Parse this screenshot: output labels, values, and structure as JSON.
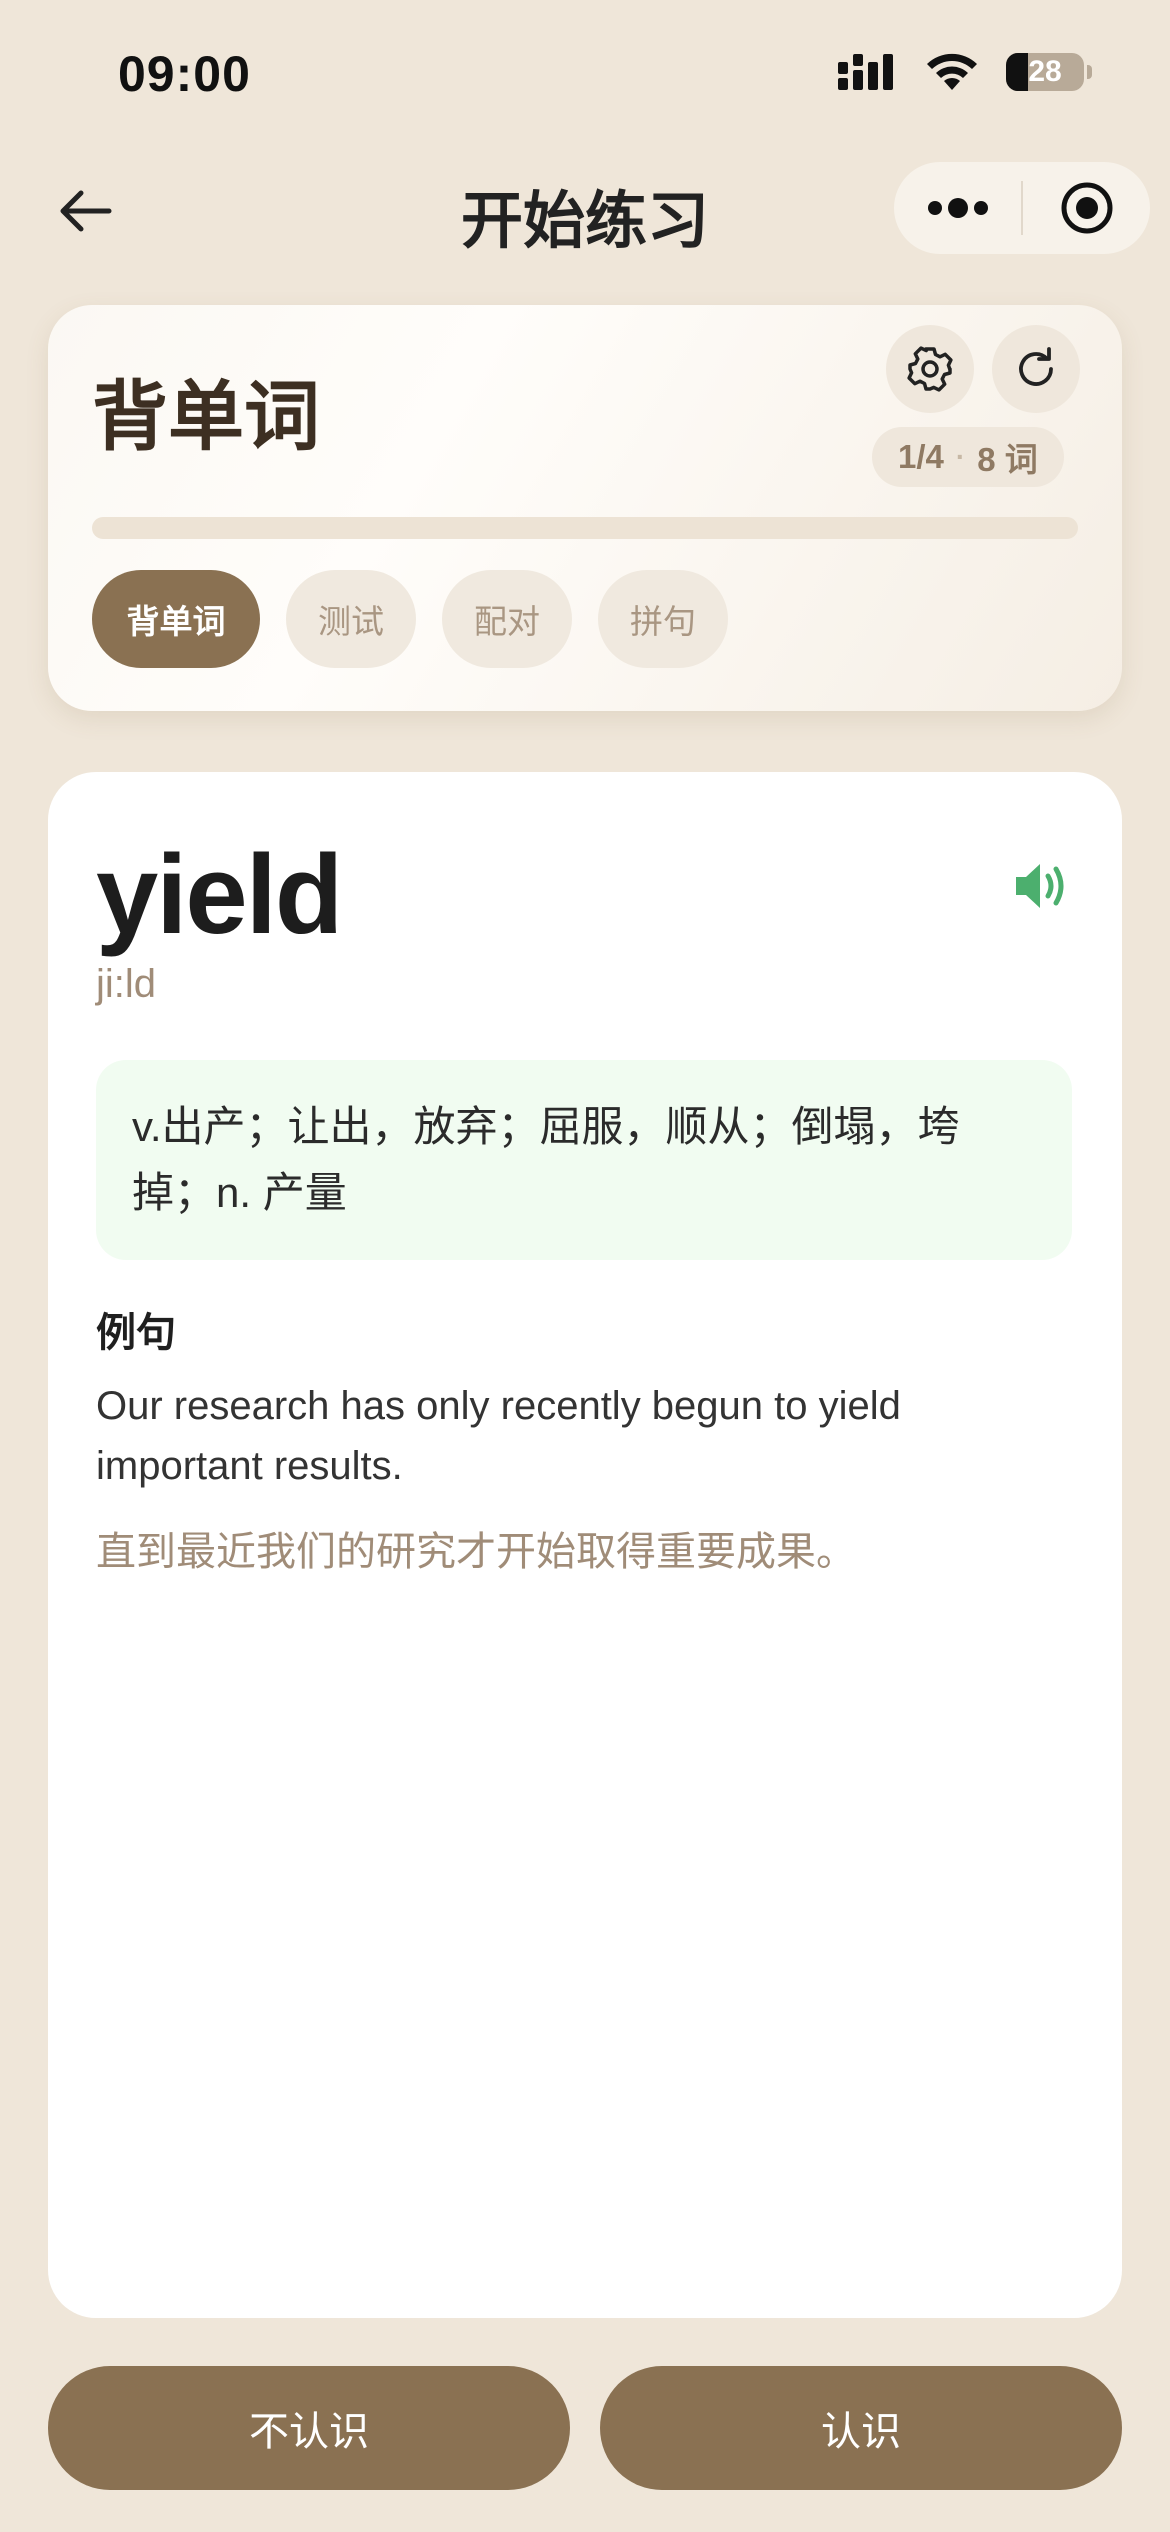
{
  "status_bar": {
    "time": "09:00",
    "battery": "28",
    "battery_level": 0.28
  },
  "nav": {
    "title": "开始练习",
    "back_icon": "arrow-left-icon",
    "menu_icon": "more-dots-icon",
    "target_icon": "record-circle-icon"
  },
  "header": {
    "mode_title": "背单词",
    "progress": {
      "position": "1/4",
      "separator": "·",
      "count": "8 词",
      "fraction": 0
    },
    "tabs": [
      {
        "label": "背单词",
        "active": true
      },
      {
        "label": "测试",
        "active": false
      },
      {
        "label": "配对",
        "active": false
      },
      {
        "label": "拼句",
        "active": false
      }
    ]
  },
  "card": {
    "word": "yield",
    "phonetic": "ji:ld",
    "definition": "v.出产；让出，放弃；屈服，顺从；倒塌，垮掉；n. 产量",
    "example_heading": "例句",
    "example_en": "Our research has only recently begun to yield important results.",
    "example_zh": "直到最近我们的研究才开始取得重要成果。"
  },
  "actions": {
    "unknown": "不认识",
    "known": "认识"
  },
  "colors": {
    "background": "#efe6d9",
    "accent": "#8a7152",
    "speaker_green": "#4caf6e",
    "definition_bg": "#f1fcf1"
  }
}
